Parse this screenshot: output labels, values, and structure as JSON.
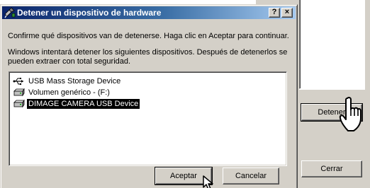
{
  "dialog": {
    "title": "Detener un dispositivo de hardware",
    "help_button": "?",
    "close_button": "×",
    "message_confirm": "Confirme qué dispositivos van de detenerse. Haga clic en Aceptar para continuar.",
    "message_info": "Windows intentará detener los siguientes dispositivos. Después de detenerlos se pueden extraer con total seguridad.",
    "devices": [
      {
        "label": "USB Mass Storage Device",
        "icon": "usb-icon",
        "selected": false
      },
      {
        "label": "Volumen genérico - (F:)",
        "icon": "drive-icon",
        "selected": false
      },
      {
        "label": "DIMAGE CAMERA USB Device",
        "icon": "drive-icon",
        "selected": true
      }
    ],
    "accept_label": "Aceptar",
    "cancel_label": "Cancelar"
  },
  "background_window": {
    "stop_label": "Detener",
    "close_label": "Cerrar"
  },
  "cursors": {
    "hand": "hand-pointer-icon",
    "arrow": "arrow-pointer-icon"
  }
}
